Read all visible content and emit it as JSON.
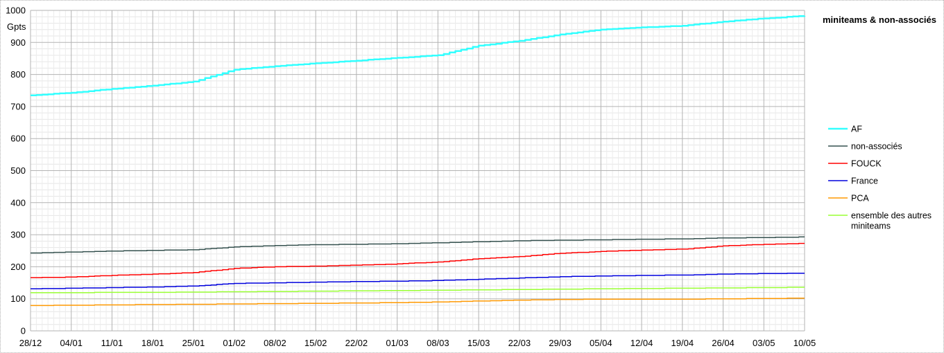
{
  "chart_data": {
    "type": "line",
    "title": "miniteams & non-associés",
    "ylabel": "Gpts",
    "xlabel": "",
    "ylim": [
      0,
      1000
    ],
    "yticks": [
      "0",
      "100",
      "200",
      "300",
      "400",
      "500",
      "600",
      "700",
      "800",
      "900",
      "1000"
    ],
    "xtick_labels": [
      "28/12",
      "04/01",
      "11/01",
      "18/01",
      "25/01",
      "01/02",
      "08/02",
      "15/02",
      "22/02",
      "01/03",
      "08/03",
      "15/03",
      "22/03",
      "29/03",
      "05/04",
      "12/04",
      "19/04",
      "26/04",
      "03/05",
      "10/05"
    ],
    "legend_position": "right",
    "grid": true,
    "series": [
      {
        "name": "AF",
        "color": "#33ffff",
        "width": 2.5,
        "x": [
          0,
          7,
          14,
          21,
          28,
          35,
          42,
          49,
          56,
          63,
          70,
          77,
          84,
          91,
          98,
          105,
          112,
          119,
          126,
          133
        ],
        "y": [
          735,
          743,
          755,
          765,
          778,
          815,
          826,
          835,
          843,
          852,
          860,
          890,
          905,
          925,
          940,
          947,
          952,
          965,
          975,
          983
        ]
      },
      {
        "name": "non-associés",
        "color": "#34504e",
        "width": 1.5,
        "x": [
          0,
          7,
          14,
          21,
          28,
          35,
          42,
          49,
          56,
          63,
          70,
          77,
          84,
          91,
          98,
          105,
          112,
          119,
          126,
          133
        ],
        "y": [
          243,
          246,
          249,
          251,
          253,
          262,
          266,
          269,
          270,
          272,
          275,
          278,
          281,
          283,
          284,
          286,
          287,
          290,
          291,
          293
        ]
      },
      {
        "name": "FOUCK",
        "color": "#ff0000",
        "width": 1.5,
        "x": [
          0,
          7,
          14,
          21,
          28,
          35,
          42,
          49,
          56,
          63,
          70,
          77,
          84,
          91,
          98,
          105,
          112,
          119,
          126,
          133
        ],
        "y": [
          166,
          168,
          173,
          177,
          182,
          195,
          200,
          202,
          205,
          209,
          215,
          225,
          232,
          242,
          248,
          252,
          255,
          265,
          270,
          273
        ]
      },
      {
        "name": "France",
        "color": "#0000dd",
        "width": 1.5,
        "x": [
          0,
          7,
          14,
          21,
          28,
          35,
          42,
          49,
          56,
          63,
          70,
          77,
          84,
          91,
          98,
          105,
          112,
          119,
          126,
          133
        ],
        "y": [
          131,
          133,
          135,
          137,
          140,
          148,
          150,
          152,
          154,
          155,
          157,
          161,
          165,
          169,
          171,
          173,
          174,
          177,
          179,
          180
        ]
      },
      {
        "name": "PCA",
        "color": "#ff9900",
        "width": 1.5,
        "x": [
          0,
          7,
          14,
          21,
          28,
          35,
          42,
          49,
          56,
          63,
          70,
          77,
          84,
          91,
          98,
          105,
          112,
          119,
          126,
          133
        ],
        "y": [
          79,
          80,
          81,
          82,
          83,
          84,
          85,
          86,
          87,
          88,
          90,
          93,
          96,
          98,
          99,
          99,
          99,
          100,
          101,
          102
        ]
      },
      {
        "name": "ensemble des autres miniteams",
        "color": "#99ff33",
        "width": 1.5,
        "x": [
          0,
          7,
          14,
          21,
          28,
          35,
          42,
          49,
          56,
          63,
          70,
          77,
          84,
          91,
          98,
          105,
          112,
          119,
          126,
          133
        ],
        "y": [
          119,
          119,
          120,
          120,
          121,
          122,
          123,
          124,
          125,
          126,
          127,
          128,
          129,
          130,
          131,
          132,
          133,
          134,
          135,
          136
        ]
      }
    ]
  }
}
